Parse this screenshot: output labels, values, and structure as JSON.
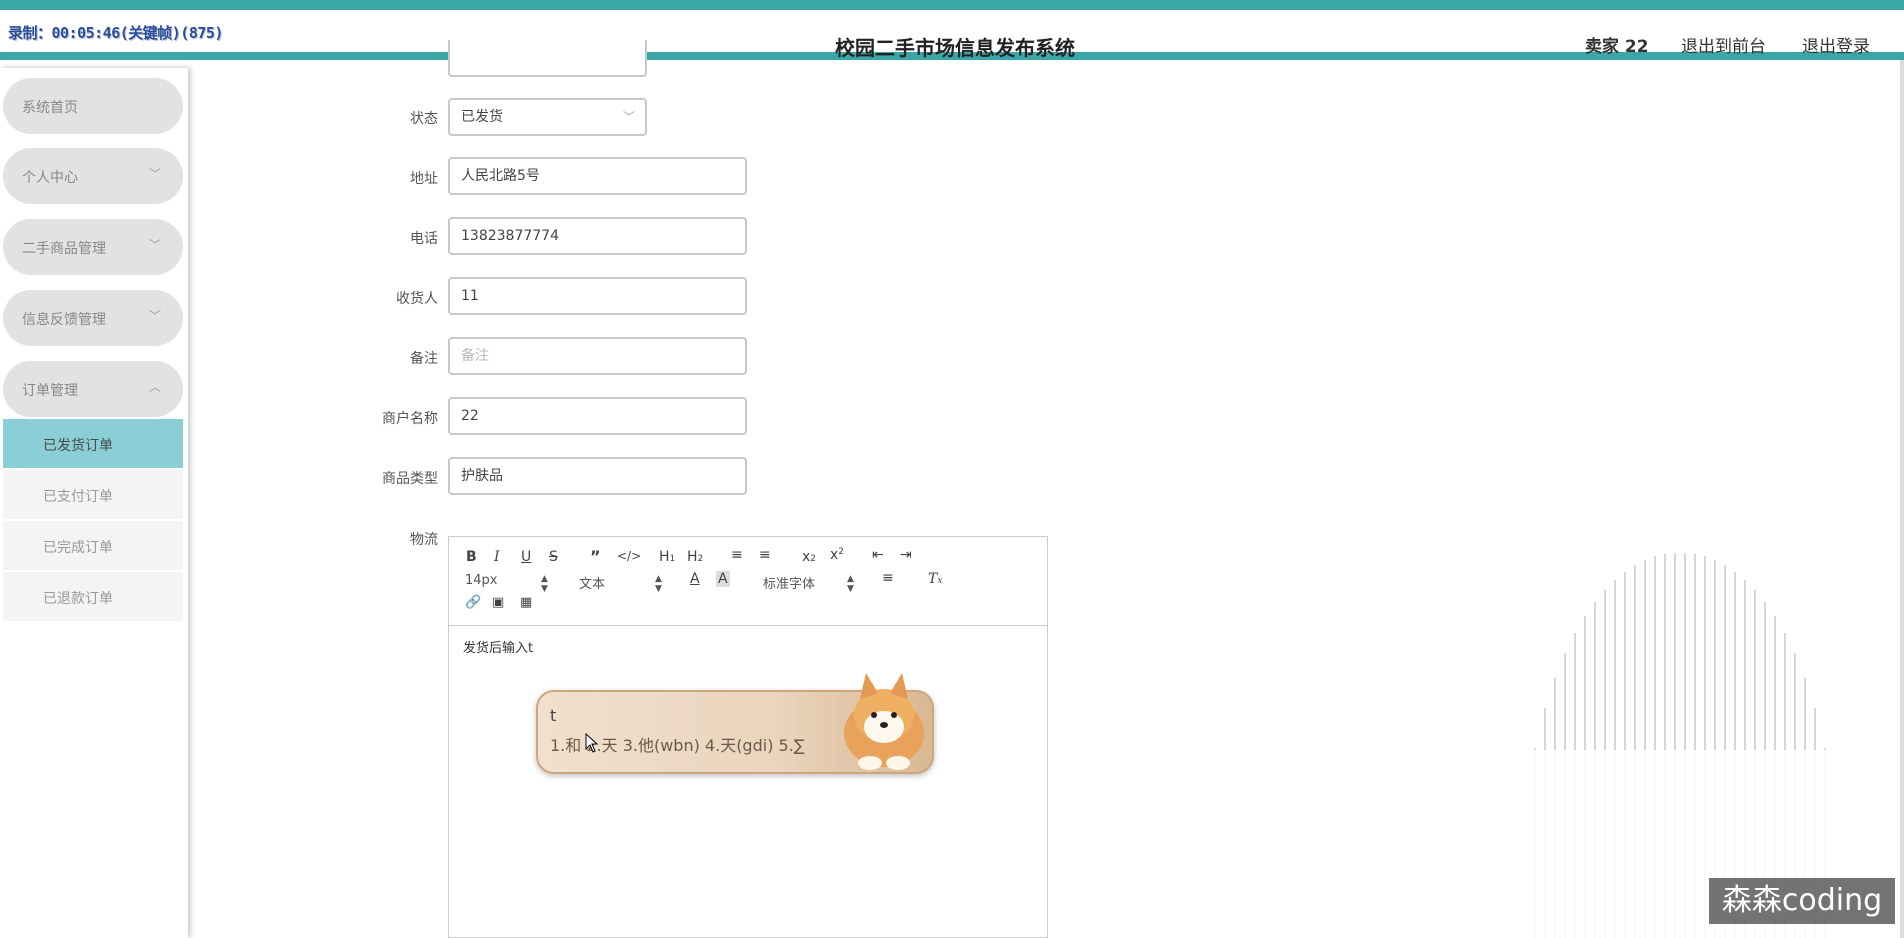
{
  "recording": "录制：00:05:46(关键帧)(875)",
  "header": {
    "title": "校园二手市场信息发布系统",
    "user": "卖家 22",
    "to_front": "退出到前台",
    "logout": "退出登录"
  },
  "sidebar": {
    "items": [
      {
        "label": "系统首页",
        "expandable": false
      },
      {
        "label": "个人中心",
        "expandable": true,
        "chevron": "﹀"
      },
      {
        "label": "二手商品管理",
        "expandable": true,
        "chevron": "﹀"
      },
      {
        "label": "信息反馈管理",
        "expandable": true,
        "chevron": "﹀"
      },
      {
        "label": "订单管理",
        "expandable": true,
        "chevron": "︿"
      }
    ],
    "sub_items": [
      {
        "label": "已发货订单",
        "active": true
      },
      {
        "label": "已支付订单",
        "active": false
      },
      {
        "label": "已完成订单",
        "active": false
      },
      {
        "label": "已退款订单",
        "active": false
      }
    ]
  },
  "form": {
    "status": {
      "label": "状态",
      "value": "已发货",
      "arrow": "﹀"
    },
    "address": {
      "label": "地址",
      "value": "人民北路5号"
    },
    "phone": {
      "label": "电话",
      "value": "13823877774"
    },
    "receiver": {
      "label": "收货人",
      "value": "11"
    },
    "remark": {
      "label": "备注",
      "placeholder": "备注"
    },
    "merchant": {
      "label": "商户名称",
      "value": "22"
    },
    "category": {
      "label": "商品类型",
      "value": "护肤品"
    },
    "logistics": {
      "label": "物流"
    }
  },
  "editor": {
    "font_size": "14px",
    "block": "文本",
    "font_family": "标准字体",
    "content": "发货后输入t"
  },
  "ime": {
    "composition": "t",
    "candidates": "1.和  2.天  3.他(wbn)  4.天(gdi)  5.∑"
  },
  "watermark": "森森coding",
  "colors": {
    "accent": "#3aa6a8",
    "active_sub": "#8acfd6"
  }
}
